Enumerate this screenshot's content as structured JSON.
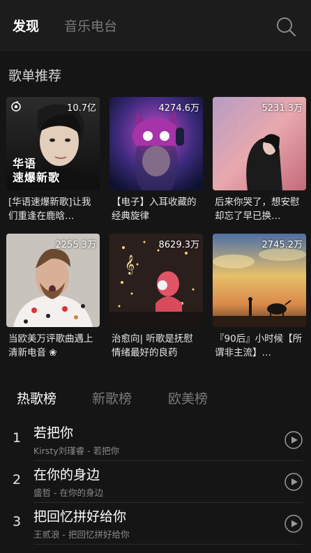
{
  "header": {
    "tabs": [
      {
        "label": "发现",
        "active": true
      },
      {
        "label": "音乐电台",
        "active": false
      }
    ],
    "search_icon": "search-icon"
  },
  "playlist_section": {
    "title": "歌单推荐",
    "cards": [
      {
        "count": "10.7亿",
        "overlay": "华语\n速爆新歌",
        "caption": "[华语速爆新歌]让我们重逢在鹿晗…",
        "icon": "radio-icon"
      },
      {
        "count": "4274.6万",
        "caption": "【电子】入耳收藏的经典旋律"
      },
      {
        "count": "5231.3万",
        "caption": "后来你哭了，想安慰却忘了早已换…"
      },
      {
        "count": "2255.3万",
        "caption": "当欧美万评歌曲遇上清新电音 ❀"
      },
      {
        "count": "8629.3万",
        "caption": "治愈向| 听歌是抚慰情绪最好的良药"
      },
      {
        "count": "2745.2万",
        "caption": "『90后』小时候【所谓非主流】…"
      }
    ]
  },
  "chart_tabs": [
    {
      "label": "热歌榜",
      "active": true
    },
    {
      "label": "新歌榜",
      "active": false
    },
    {
      "label": "欧美榜",
      "active": false
    }
  ],
  "songs": [
    {
      "rank": "1",
      "title": "若把你",
      "sub": "Kirsty刘瑾睿 - 若把你"
    },
    {
      "rank": "2",
      "title": "在你的身边",
      "sub": "盛哲 - 在你的身边"
    },
    {
      "rank": "3",
      "title": "把回忆拼好给你",
      "sub": "王贰浪 - 把回忆拼好给你"
    }
  ],
  "colors": {
    "background": "#151515",
    "header": "#1c1c1c",
    "inactive_text": "#7a7a7a",
    "subtext": "#8a8a8a"
  }
}
